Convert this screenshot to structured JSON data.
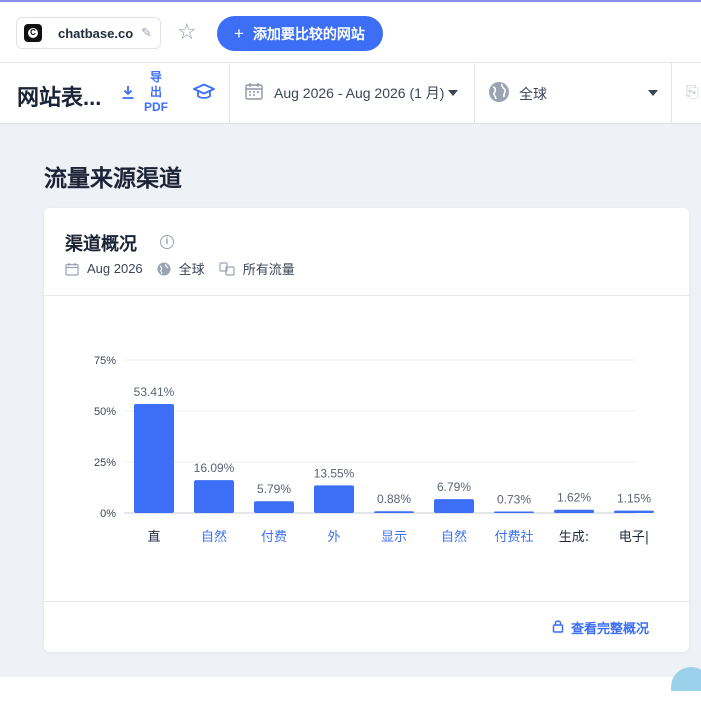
{
  "header": {
    "site_name": "chatbase.co",
    "favicon_letter": "C",
    "add_site_label": "添加要比较的网站"
  },
  "toolbar": {
    "page_title": "网站表...",
    "export_line1": "导",
    "export_line2": "出",
    "export_line3": "PDF",
    "date_range": "Aug 2026 - Aug 2026 (1 月)",
    "region": "全球"
  },
  "section": {
    "title": "流量来源渠道"
  },
  "card": {
    "title": "渠道概况",
    "meta_date": "Aug 2026",
    "meta_region": "全球",
    "meta_traffic": "所有流量",
    "footer_link": "查看完整概况"
  },
  "colors": {
    "accent": "#3c6ff5",
    "bar": "#3c6ff5"
  },
  "chart_data": {
    "type": "bar",
    "categories": [
      "直",
      "自然",
      "付费",
      "外",
      "显示",
      "自然",
      "付费社",
      "生成:",
      "电子|"
    ],
    "category_link": [
      false,
      true,
      true,
      true,
      true,
      true,
      true,
      false,
      false
    ],
    "values": [
      53.41,
      16.09,
      5.79,
      13.55,
      0.88,
      6.79,
      0.73,
      1.62,
      1.15
    ],
    "value_labels": [
      "53.41%",
      "16.09%",
      "5.79%",
      "13.55%",
      "0.88%",
      "6.79%",
      "0.73%",
      "1.62%",
      "1.15%"
    ],
    "yticks": [
      "0%",
      "25%",
      "50%",
      "75%"
    ],
    "ytick_values": [
      0,
      25,
      50,
      75
    ],
    "ylim": [
      0,
      75
    ],
    "grid": true
  }
}
